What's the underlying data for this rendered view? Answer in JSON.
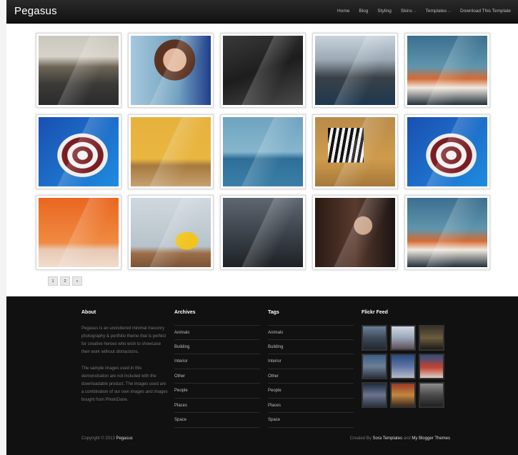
{
  "header": {
    "logo": "Pegasus",
    "nav": [
      "Home",
      "Blog",
      "Styling",
      "Skins",
      "Templates",
      "Download This Template"
    ]
  },
  "gallery": [
    {
      "image": "winding-road-photo"
    },
    {
      "image": "smiling-woman-photo"
    },
    {
      "image": "serpentine-road-photo"
    },
    {
      "image": "city-skyline-photo"
    },
    {
      "image": "shuttle-launch-photo"
    },
    {
      "image": "striped-umbrella-photo"
    },
    {
      "image": "yellow-interior-photo"
    },
    {
      "image": "heron-photo"
    },
    {
      "image": "zebra-photo"
    },
    {
      "image": "striped-umbrella-photo"
    },
    {
      "image": "orange-chair-photo"
    },
    {
      "image": "yellow-armchair-photo"
    },
    {
      "image": "dark-landscape-photo"
    },
    {
      "image": "masked-woman-photo"
    },
    {
      "image": "shuttle-launch-photo"
    }
  ],
  "pagination": {
    "page1": "1",
    "page2": "2",
    "next": "»"
  },
  "footer": {
    "about": {
      "heading": "About",
      "p1": "Pegasus is an uncluttered minimal masonry photography & portfolio theme that is perfect for creative heroes who wish to showcase their work without distractions.",
      "p2": "The sample images used in this demonstration are not included with the downloadable product. The images used are a combination of our own images and images bought from PhotoDune."
    },
    "archives": {
      "heading": "Archives",
      "items": [
        "Animals",
        "Building",
        "Interior",
        "Other",
        "People",
        "Places",
        "Space"
      ]
    },
    "tags": {
      "heading": "Tags",
      "items": [
        "Animals",
        "Building",
        "Interior",
        "Other",
        "People",
        "Places",
        "Space"
      ]
    },
    "flickr": {
      "heading": "Flickr Feed"
    },
    "copyright_prefix": "Copyright © 2013",
    "copyright_name": "Pegasus",
    "credits_prefix": "Created By",
    "credits_by": "Sora Templates",
    "credits_and": "and",
    "credits_partner": "My Blogger Themes"
  }
}
